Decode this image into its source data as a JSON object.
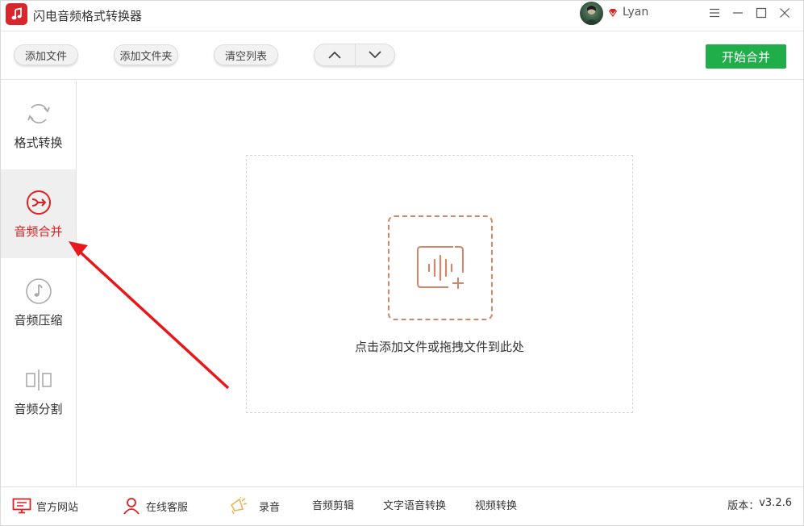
{
  "app": {
    "title": "闪电音频格式转换器",
    "username": "Lyan"
  },
  "toolbar": {
    "add_file": "添加文件",
    "add_folder": "添加文件夹",
    "clear_list": "清空列表",
    "start": "开始合并"
  },
  "sidebar": {
    "items": [
      {
        "label": "格式转换",
        "icon": "refresh-icon",
        "active": false
      },
      {
        "label": "音频合并",
        "icon": "merge-icon",
        "active": true
      },
      {
        "label": "音频压缩",
        "icon": "music-note-icon",
        "active": false
      },
      {
        "label": "音频分割",
        "icon": "split-icon",
        "active": false
      }
    ]
  },
  "main": {
    "drop_hint": "点击添加文件或拖拽文件到此处"
  },
  "bottombar": {
    "website": "官方网站",
    "support": "在线客服",
    "record": "录音",
    "audio_edit": "音频剪辑",
    "tts": "文字语音转换",
    "video_convert": "视频转换",
    "version_label": "版本：",
    "version_value": "v3.2.6"
  },
  "colors": {
    "accent_red": "#e02020",
    "start_green": "#1fae4a",
    "drop_icon": "#d2876a"
  }
}
